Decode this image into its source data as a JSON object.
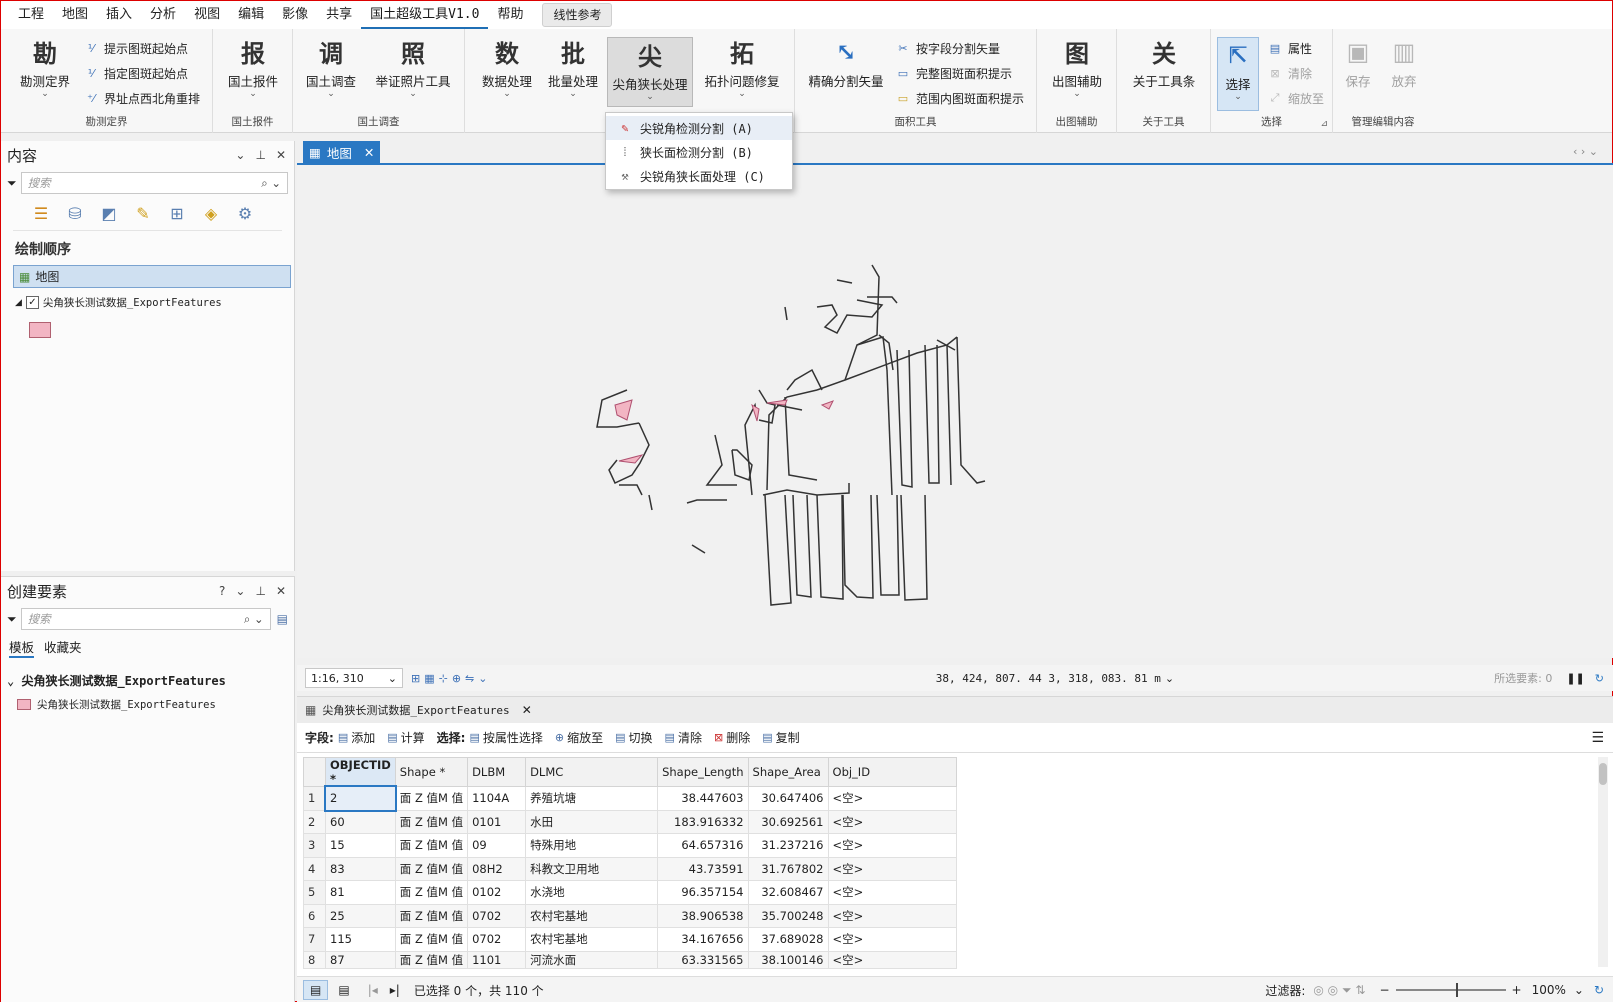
{
  "menubar": {
    "items": [
      "工程",
      "地图",
      "插入",
      "分析",
      "视图",
      "编辑",
      "影像",
      "共享",
      "国土超级工具V1.0",
      "帮助"
    ],
    "ref_button": "线性参考"
  },
  "ribbon": {
    "g1": {
      "big": "勘测定界",
      "small": [
        "提示图斑起始点",
        "指定图斑起始点",
        "界址点西北角重排"
      ],
      "label": "勘测定界"
    },
    "g2": {
      "big": "国土报件",
      "label": "国土报件"
    },
    "g3": {
      "big1": "国土调查",
      "big2": "举证照片工具",
      "label": "国土调查"
    },
    "g4": {
      "b1": "数据处理",
      "b2": "批量处理",
      "b3": "尖角狭长处理",
      "b4": "拓扑问题修复"
    },
    "g5": {
      "big": "精确分割矢量",
      "small": [
        "按字段分割矢量",
        "完整图斑面积提示",
        "范围内图斑面积提示"
      ],
      "label": "面积工具"
    },
    "g6": {
      "big": "出图辅助",
      "label": "出图辅助"
    },
    "g7": {
      "big": "关于工具条",
      "label": "关于工具"
    },
    "g8": {
      "big": "选择",
      "small": [
        "属性",
        "清除",
        "缩放至"
      ],
      "label": "选择"
    },
    "g9": {
      "b1": "保存",
      "b2": "放弃",
      "label": "管理编辑内容"
    }
  },
  "dropdown": {
    "items": [
      "尖锐角检测分割 (A)",
      "狭长面检测分割 (B)",
      "尖锐角狭长面处理 (C)"
    ]
  },
  "contents": {
    "title": "内容",
    "search_placeholder": "搜索",
    "draw_order": "绘制顺序",
    "map_item": "地图",
    "layer": "尖角狭长测试数据_ExportFeatures"
  },
  "create": {
    "title": "创建要素",
    "search_placeholder": "搜索",
    "tab1": "模板",
    "tab2": "收藏夹",
    "group": "尖角狭长测试数据_ExportFeatures",
    "template": "尖角狭长测试数据_ExportFeatures"
  },
  "map": {
    "tab": "地图",
    "scale": "1:16, 310",
    "coords": "38, 424, 807. 44  3, 318, 083. 81  m",
    "selected": "所选要素: 0"
  },
  "table": {
    "tab": "尖角狭长测试数据_ExportFeatures",
    "toolbar": {
      "field": "字段:",
      "add": "添加",
      "calc": "计算",
      "select": "选择:",
      "by_attr": "按属性选择",
      "zoom": "缩放至",
      "switch": "切换",
      "clear": "清除",
      "delete": "删除",
      "copy": "复制"
    },
    "columns": [
      "OBJECTID *",
      "Shape *",
      "DLBM",
      "DLMC",
      "Shape_Length",
      "Shape_Area",
      "Obj_ID"
    ],
    "rows": [
      [
        "1",
        "2",
        "面 Z 值M 值",
        "1104A",
        "养殖坑塘",
        "38.447603",
        "30.647406",
        "<空>"
      ],
      [
        "2",
        "60",
        "面 Z 值M 值",
        "0101",
        "水田",
        "183.916332",
        "30.692561",
        "<空>"
      ],
      [
        "3",
        "15",
        "面 Z 值M 值",
        "09",
        "特殊用地",
        "64.657316",
        "31.237216",
        "<空>"
      ],
      [
        "4",
        "83",
        "面 Z 值M 值",
        "08H2",
        "科教文卫用地",
        "43.73591",
        "31.767802",
        "<空>"
      ],
      [
        "5",
        "81",
        "面 Z 值M 值",
        "0102",
        "水浇地",
        "96.357154",
        "32.608467",
        "<空>"
      ],
      [
        "6",
        "25",
        "面 Z 值M 值",
        "0702",
        "农村宅基地",
        "38.906538",
        "35.700248",
        "<空>"
      ],
      [
        "7",
        "115",
        "面 Z 值M 值",
        "0702",
        "农村宅基地",
        "34.167656",
        "37.689028",
        "<空>"
      ],
      [
        "8",
        "87",
        "面 Z 值M 值",
        "1101",
        "河流水面",
        "63.331565",
        "38.100146",
        "<空>"
      ]
    ],
    "status": "已选择 0 个，共 110 个",
    "filter": "过滤器:",
    "zoom": "100%"
  }
}
